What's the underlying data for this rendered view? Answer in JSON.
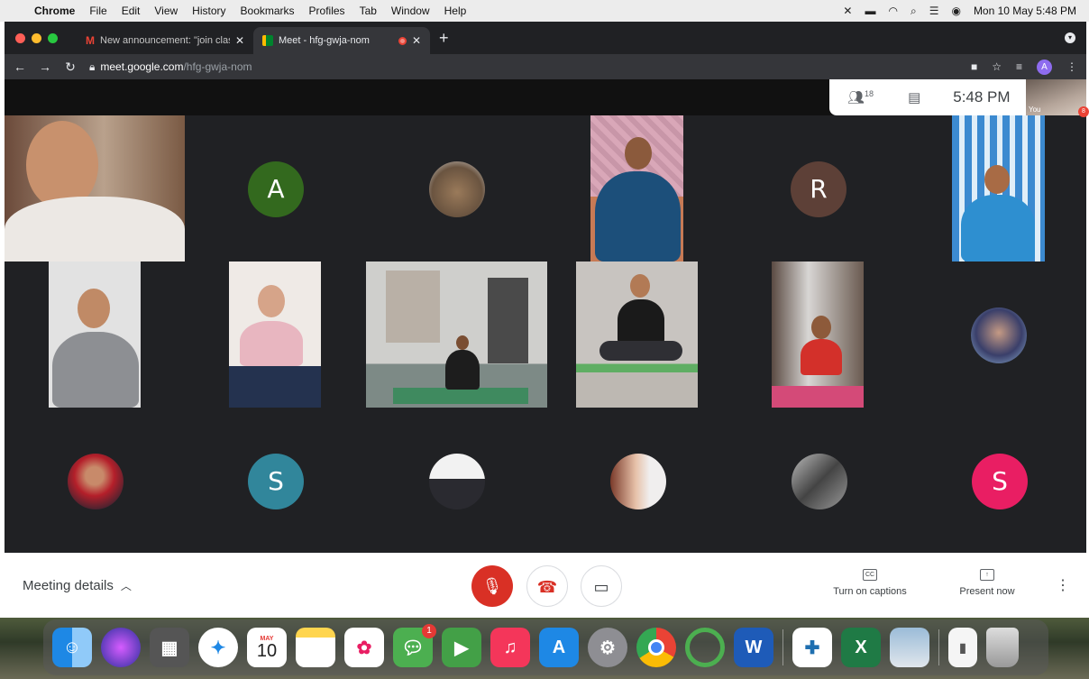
{
  "menubar": {
    "app": "Chrome",
    "items": [
      "File",
      "Edit",
      "View",
      "History",
      "Bookmarks",
      "Profiles",
      "Tab",
      "Window",
      "Help"
    ],
    "clock": "Mon 10 May  5:48 PM"
  },
  "tabs": [
    {
      "title": "New announcement: \"join clas",
      "icon": "gmail-icon"
    },
    {
      "title": "Meet - hfg-gwja-nom",
      "icon": "meet-icon"
    }
  ],
  "address": {
    "host": "meet.google.com",
    "path": "/hfg-gwja-nom"
  },
  "profile_initial": "A",
  "meet": {
    "participants_count": "18",
    "time": "5:48 PM",
    "self_label": "You",
    "self_badge": "8",
    "letter_tiles": [
      {
        "letter": "A",
        "color": "#33691e"
      },
      {
        "letter": "R",
        "color": "#5d4037"
      },
      {
        "letter": "S",
        "color": "#31869b"
      },
      {
        "letter": "S",
        "color": "#e91e63"
      }
    ]
  },
  "controls": {
    "meeting_details": "Meeting details",
    "captions": "Turn on captions",
    "present": "Present now",
    "captions_icon_text": "CC"
  },
  "dock": {
    "calendar_month": "MAY",
    "calendar_day": "10",
    "messages_badge": "1"
  }
}
